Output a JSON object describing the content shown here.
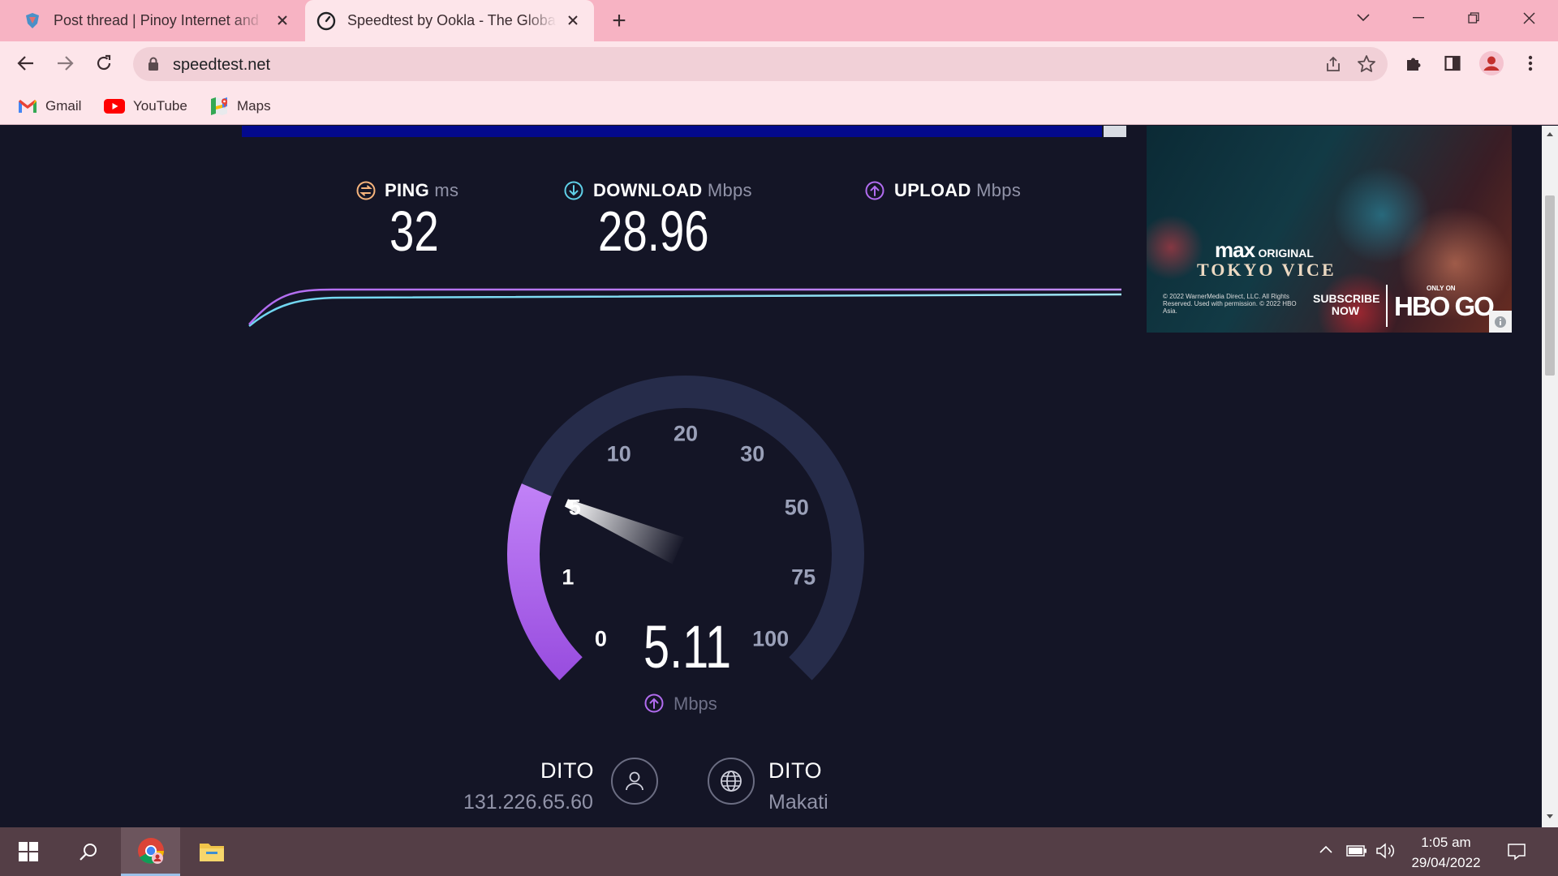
{
  "browser": {
    "tabs": [
      {
        "title": "Post thread | Pinoy Internet and Technology Forums"
      },
      {
        "title": "Speedtest by Ookla - The Global Broadband Speed Test"
      }
    ],
    "new_tab_symbol": "+",
    "url": "speedtest.net",
    "bookmarks": [
      {
        "label": "Gmail",
        "icon": "gmail-icon"
      },
      {
        "label": "YouTube",
        "icon": "youtube-icon"
      },
      {
        "label": "Maps",
        "icon": "maps-icon"
      }
    ]
  },
  "speedtest": {
    "ping": {
      "label": "PING",
      "unit": "ms",
      "value": "32"
    },
    "download": {
      "label": "DOWNLOAD",
      "unit": "Mbps",
      "value": "28.96"
    },
    "upload": {
      "label": "UPLOAD",
      "unit": "Mbps"
    },
    "gauge": {
      "ticks": [
        "0",
        "1",
        "5",
        "10",
        "20",
        "30",
        "50",
        "75",
        "100"
      ],
      "current_value": "5.11",
      "current_unit": "Mbps",
      "needle_value": 5.11
    },
    "isp": {
      "name": "DITO",
      "ip": "131.226.65.60"
    },
    "server": {
      "name": "DITO",
      "location": "Makati"
    }
  },
  "ad": {
    "brand": "max",
    "brand_suffix": "ORIGINAL",
    "show_title": "TOKYO VICE",
    "legal": "© 2022 WarnerMedia Direct, LLC. All Rights Reserved. Used with permission. © 2022 HBO Asia.",
    "cta": "SUBSCRIBE NOW",
    "only_on": "ONLY ON",
    "service": "HBO GO"
  },
  "taskbar": {
    "time": "1:05 am",
    "date": "29/04/2022"
  },
  "colors": {
    "tab_strip": "#f7b3c3",
    "toolbar": "#fde5ea",
    "page_bg": "#141526",
    "gauge_accent": "#b26cf0",
    "ping_icon": "#f6b47c",
    "download_icon": "#5fd0e8",
    "upload_icon": "#b26cf0",
    "taskbar": "#543e46"
  }
}
